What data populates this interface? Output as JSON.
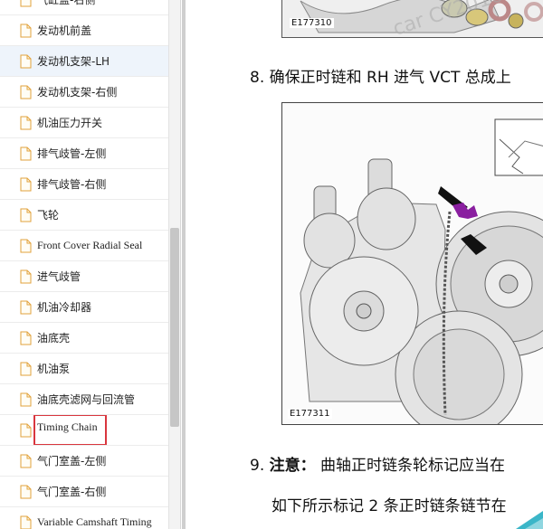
{
  "sidebar": {
    "items": [
      {
        "label": "气缸盖-右侧",
        "serif": false
      },
      {
        "label": "发动机前盖",
        "serif": false
      },
      {
        "label": "发动机支架-LH",
        "serif": false,
        "selected": true
      },
      {
        "label": "发动机支架-右侧",
        "serif": false
      },
      {
        "label": "机油压力开关",
        "serif": false
      },
      {
        "label": "排气歧管-左侧",
        "serif": false
      },
      {
        "label": "排气歧管-右侧",
        "serif": false
      },
      {
        "label": "飞轮",
        "serif": false
      },
      {
        "label": "Front Cover Radial Seal",
        "serif": true
      },
      {
        "label": "进气歧管",
        "serif": false
      },
      {
        "label": "机油冷却器",
        "serif": false
      },
      {
        "label": "油底壳",
        "serif": false
      },
      {
        "label": "机油泵",
        "serif": false
      },
      {
        "label": "油底壳滤网与回流管",
        "serif": false
      },
      {
        "label": "Timing Chain",
        "serif": true,
        "highlighted": true
      },
      {
        "label": "气门室盖-左侧",
        "serif": false
      },
      {
        "label": "气门室盖-右侧",
        "serif": false
      },
      {
        "label": "Variable Camshaft Timing",
        "serif": true
      }
    ]
  },
  "content": {
    "figure_top_caption": "E177310",
    "step8": {
      "number": "8.",
      "text": "确保正时链和 RH 进气 VCT 总成上"
    },
    "figure_main_caption": "E177311",
    "step9": {
      "number": "9.",
      "note_label": "注意：",
      "text": "曲轴正时链条轮标记应当在"
    },
    "step9_cont": "如下所示标记 2 条正时链条链节在"
  },
  "colors": {
    "highlight_box": "#d9363e",
    "marker": "#8a1fa0",
    "selected_bg": "#eef4fb"
  }
}
